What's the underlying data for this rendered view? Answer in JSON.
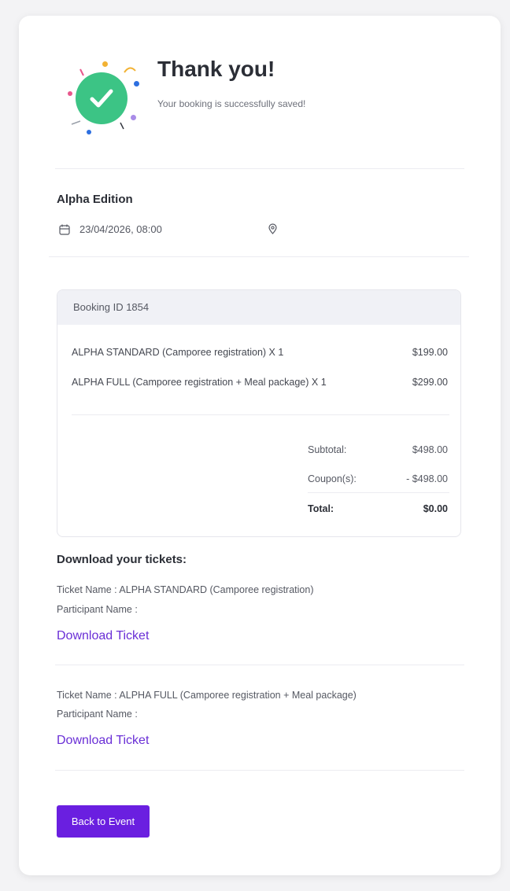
{
  "header": {
    "title": "Thank you!",
    "subtitle": "Your booking is successfully saved!",
    "accent": "#3cc485"
  },
  "event": {
    "name": "Alpha Edition",
    "datetime": "23/04/2026, 08:00",
    "calendar_icon": "calendar-icon",
    "location_icon": "map-pin-icon"
  },
  "booking": {
    "id_label": "Booking ID 1854",
    "items": [
      {
        "name": "ALPHA STANDARD (Camporee registration) X 1",
        "price": "$199.00"
      },
      {
        "name": "ALPHA FULL (Camporee registration + Meal package) X 1",
        "price": "$299.00"
      }
    ],
    "subtotal_label": "Subtotal:",
    "subtotal_value": "$498.00",
    "coupon_label": "Coupon(s):",
    "coupon_value": "- $498.00",
    "total_label": "Total:",
    "total_value": "$0.00"
  },
  "downloads": {
    "heading": "Download your tickets:",
    "tickets": [
      {
        "ticket_line": "Ticket Name : ALPHA STANDARD (Camporee registration)",
        "participant_line": "Participant Name :",
        "link": "Download Ticket"
      },
      {
        "ticket_line": "Ticket Name : ALPHA FULL (Camporee registration + Meal package)",
        "participant_line": "Participant Name :",
        "link": "Download Ticket"
      }
    ]
  },
  "actions": {
    "back_label": "Back to Event",
    "button_color": "#6a1fe0",
    "link_color": "#6a2fd6"
  }
}
